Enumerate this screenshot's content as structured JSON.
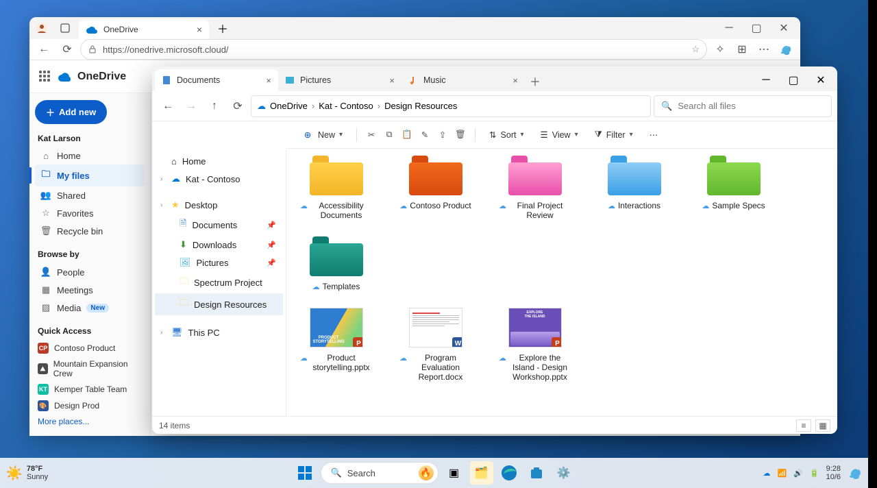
{
  "browser": {
    "tab_title": "OneDrive",
    "url": "https://onedrive.microsoft.cloud/"
  },
  "onedrive": {
    "app_name": "OneDrive",
    "add_new": "Add new",
    "user_name": "Kat Larson",
    "nav": {
      "home": "Home",
      "my_files": "My files",
      "shared": "Shared",
      "favorites": "Favorites",
      "recycle": "Recycle bin"
    },
    "browse_by_title": "Browse by",
    "browse": {
      "people": "People",
      "meetings": "Meetings",
      "media": "Media",
      "new_badge": "New"
    },
    "quick_access_title": "Quick Access",
    "quick_access": [
      {
        "label": "Contoso Product",
        "bg": "#b93a28",
        "initials": "CP"
      },
      {
        "label": "Mountain Expansion Crew",
        "bg": "#4b4b4b",
        "initials": "⛰"
      },
      {
        "label": "Kemper Table Team",
        "bg": "#0fbfa5",
        "initials": "KT"
      },
      {
        "label": "Design Prod",
        "bg": "#2b579a",
        "initials": "🎨"
      }
    ],
    "more_places": "More places..."
  },
  "explorer": {
    "tabs": [
      {
        "label": "Documents",
        "icon": "doc",
        "active": true
      },
      {
        "label": "Pictures",
        "icon": "pic",
        "active": false
      },
      {
        "label": "Music",
        "icon": "music",
        "active": false
      }
    ],
    "breadcrumb": [
      "OneDrive",
      "Kat - Contoso",
      "Design Resources"
    ],
    "search_placeholder": "Search all files",
    "toolbar": {
      "new": "New",
      "sort": "Sort",
      "view": "View",
      "filter": "Filter"
    },
    "nav_items": {
      "home": "Home",
      "kat": "Kat - Contoso",
      "desktop": "Desktop",
      "documents": "Documents",
      "downloads": "Downloads",
      "pictures": "Pictures",
      "spectrum": "Spectrum Project",
      "design_resources": "Design Resources",
      "this_pc": "This PC"
    },
    "folders": [
      {
        "name": "Accessibility Documents",
        "tab": "#f3b529",
        "body": "#ffd04a"
      },
      {
        "name": "Contoso Product",
        "tab": "#d84a0e",
        "body": "#f26a1b"
      },
      {
        "name": "Final Project Review",
        "tab": "#e84faa",
        "body": "#ff9fd1"
      },
      {
        "name": "Interactions",
        "tab": "#3aa0e8",
        "body": "#8ecdf5"
      },
      {
        "name": "Sample Specs",
        "tab": "#62b72d",
        "body": "#8dd94e"
      },
      {
        "name": "Templates",
        "tab": "#0f7e70",
        "body": "#2aa595"
      }
    ],
    "files": [
      {
        "name": "Product storytelling.pptx",
        "type": "pptx"
      },
      {
        "name": "Program Evaluation Report.docx",
        "type": "docx"
      },
      {
        "name": "Explore the Island - Design Workshop.pptx",
        "type": "pptx"
      }
    ],
    "status": "14 items"
  },
  "taskbar": {
    "search": "Search",
    "temp": "78°F",
    "weather": "Sunny",
    "time": "9:28",
    "date": "10/6"
  }
}
